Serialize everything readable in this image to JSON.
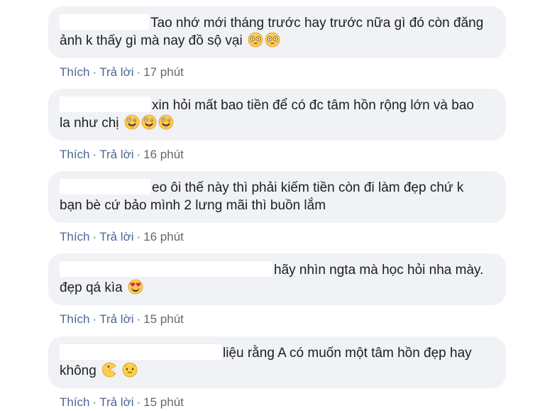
{
  "comments": [
    {
      "text_line1": "Tao nhớ mới tháng trước hay trước nữa gì đó còn đăng",
      "text_line2": "ảnh k thấy gì mà nay đồ sộ vại",
      "emojis": [
        "flushed-face-icon",
        "flushed-face-icon"
      ],
      "like_label": "Thích",
      "reply_label": "Trả lời",
      "time": "17 phút"
    },
    {
      "text_line1": "xin hỏi mất bao tiền để có đc tâm hồn rộng lớn và bao",
      "text_line2": "la như chị",
      "emojis": [
        "zany-face-icon",
        "zany-face-icon",
        "zany-face-icon"
      ],
      "like_label": "Thích",
      "reply_label": "Trả lời",
      "time": "16 phút"
    },
    {
      "text_line1": "eo ôi thế này thì phải kiếm tiền còn đi làm đẹp chứ k",
      "text_line2": "bạn bè cứ bảo mình 2 lưng mãi thì buồn lắm",
      "emojis": [],
      "like_label": "Thích",
      "reply_label": "Trả lời",
      "time": "16 phút"
    },
    {
      "text_line1": "hãy nhìn ngta mà học hỏi nha mày.",
      "text_line2": "đẹp qá kìa",
      "emojis": [
        "heart-eyes-icon"
      ],
      "like_label": "Thích",
      "reply_label": "Trả lời",
      "time": "15 phút"
    },
    {
      "text_line1": "liệu rằng A có muốn một tâm hồn đẹp hay",
      "text_line2": "không",
      "emojis": [
        "pacman-icon",
        "cute-face-icon"
      ],
      "like_label": "Thích",
      "reply_label": "Trả lời",
      "time": "15 phút"
    }
  ]
}
